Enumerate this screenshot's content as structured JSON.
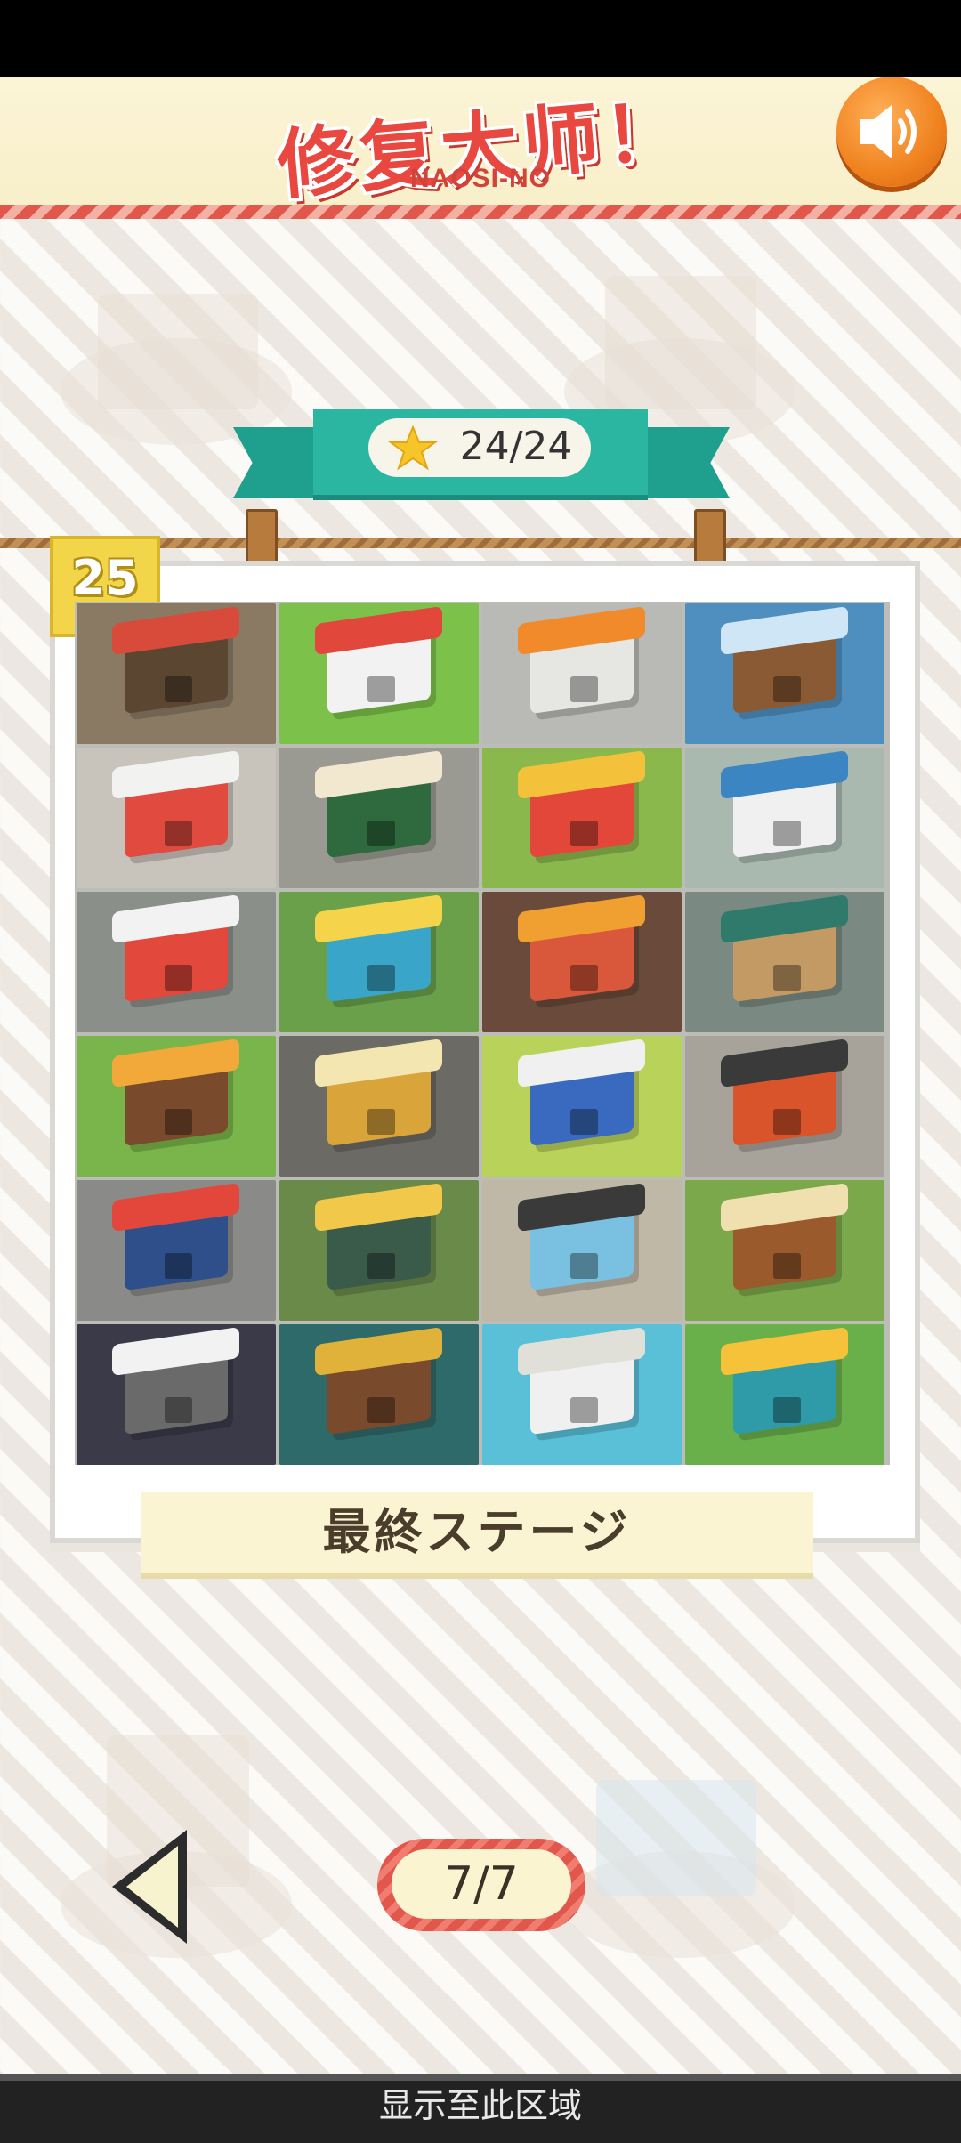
{
  "header": {
    "title": "修复大师！",
    "subtitle": "NAOSI-NO"
  },
  "icons": {
    "sound": "speaker-volume-icon",
    "star": "star-icon",
    "previous": "triangle-left-icon"
  },
  "score": {
    "current": 24,
    "total": 24,
    "label": "24/24"
  },
  "stage": {
    "number": "25",
    "label": "最終ステージ"
  },
  "tiles": [
    {
      "bg": "#8a7a64",
      "bld": "#5b4632",
      "roof": "#d84a3a"
    },
    {
      "bg": "#7cc24a",
      "bld": "#f2f2f2",
      "roof": "#e2473c"
    },
    {
      "bg": "#b9b9b5",
      "bld": "#e6e6e3",
      "roof": "#f08a2a"
    },
    {
      "bg": "#4f8fc0",
      "bld": "#8a5a34",
      "roof": "#cfe6f6"
    },
    {
      "bg": "#c9c4bb",
      "bld": "#e14a3f",
      "roof": "#f2f2f0"
    },
    {
      "bg": "#9b9a92",
      "bld": "#2f6a3e",
      "roof": "#f2e8d0"
    },
    {
      "bg": "#8ab84c",
      "bld": "#e3473a",
      "roof": "#f3c13a"
    },
    {
      "bg": "#a9b9b0",
      "bld": "#f0f0f0",
      "roof": "#3b86c2"
    },
    {
      "bg": "#8a8f8a",
      "bld": "#e2483c",
      "roof": "#f2f2f2"
    },
    {
      "bg": "#6aa04a",
      "bld": "#39a5c8",
      "roof": "#f5d34a"
    },
    {
      "bg": "#6a4a3a",
      "bld": "#d9573a",
      "roof": "#f0a030"
    },
    {
      "bg": "#7a8a82",
      "bld": "#c39a64",
      "roof": "#2f7a6a"
    },
    {
      "bg": "#79b54a",
      "bld": "#7a4a2c",
      "roof": "#f2a93a"
    },
    {
      "bg": "#6b6a64",
      "bld": "#d9a43a",
      "roof": "#f3e6b0"
    },
    {
      "bg": "#b9d25a",
      "bld": "#3a6ac0",
      "roof": "#f0f0f0"
    },
    {
      "bg": "#a8a39a",
      "bld": "#d9542a",
      "roof": "#3a3a3a"
    },
    {
      "bg": "#8a8a88",
      "bld": "#2f4f8a",
      "roof": "#e3473c"
    },
    {
      "bg": "#6a8a4a",
      "bld": "#3a5a4a",
      "roof": "#f2c84a"
    },
    {
      "bg": "#c0b8a6",
      "bld": "#7ac0e0",
      "roof": "#3a3a3a"
    },
    {
      "bg": "#7aa84a",
      "bld": "#9a5a2c",
      "roof": "#f0e0b0"
    },
    {
      "bg": "#3a3a48",
      "bld": "#6a6a6a",
      "roof": "#f2f2f2"
    },
    {
      "bg": "#2f6a6a",
      "bld": "#7a4a2c",
      "roof": "#e0b23a"
    },
    {
      "bg": "#5ac0d8",
      "bld": "#f0f0f0",
      "roof": "#e0e0d8"
    },
    {
      "bg": "#6ab04a",
      "bld": "#2f9aa8",
      "roof": "#f5c23a"
    }
  ],
  "navigation": {
    "page": "7/7"
  },
  "footer": {
    "text": "显示至此区域"
  },
  "colors": {
    "accent_red": "#e2574c",
    "teal": "#2bb6a2",
    "badge_yellow": "#f2d548",
    "orange_button": "#f0821f"
  }
}
